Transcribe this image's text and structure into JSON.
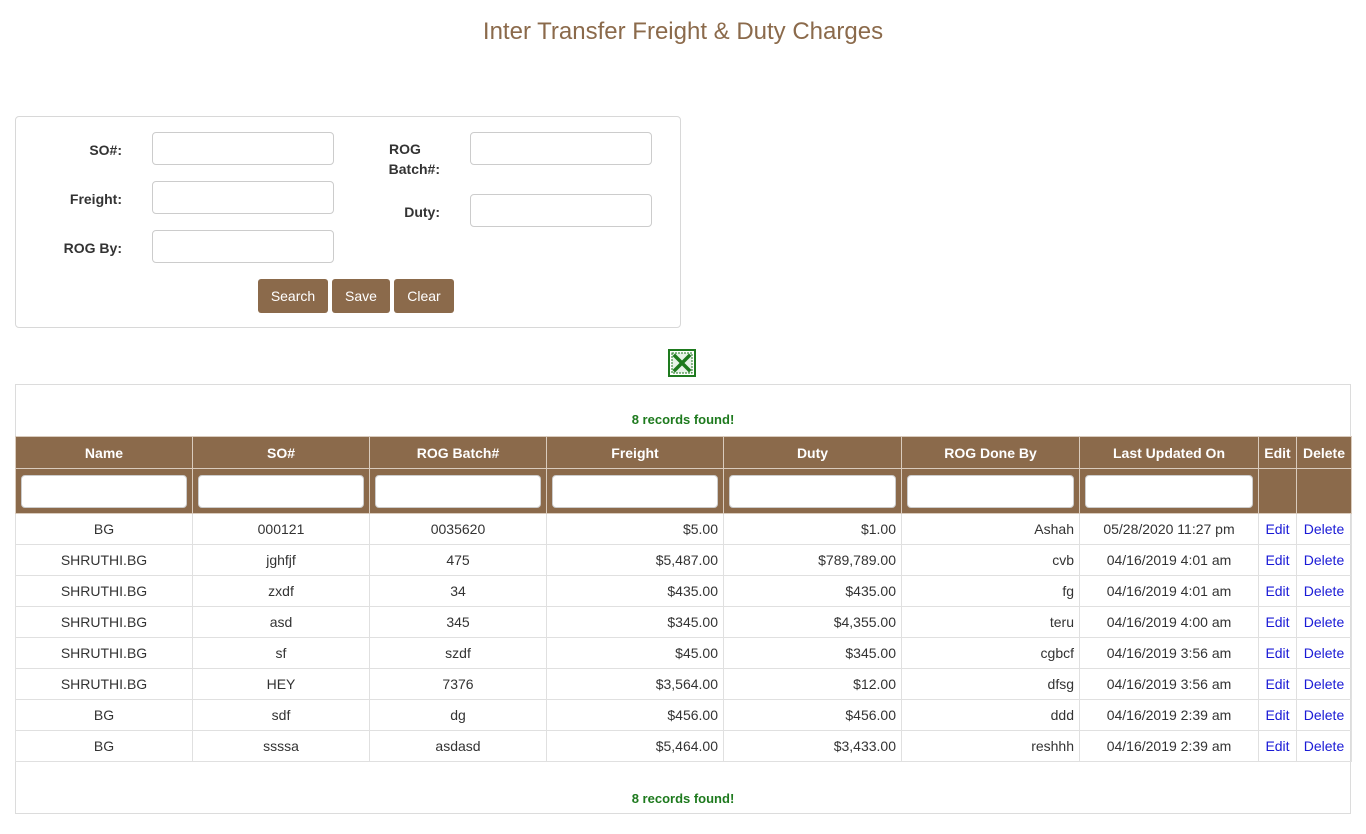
{
  "page": {
    "title": "Inter Transfer Freight & Duty Charges"
  },
  "form": {
    "so_label": "SO#:",
    "rog_batch_label_line1": "ROG",
    "rog_batch_label_line2": "Batch#:",
    "freight_label": "Freight:",
    "duty_label": "Duty:",
    "rog_by_label": "ROG By:",
    "so_value": "",
    "rog_batch_value": "",
    "freight_value": "",
    "duty_value": "",
    "rog_by_value": "",
    "search_label": "Search",
    "save_label": "Save",
    "clear_label": "Clear"
  },
  "export": {
    "icon": "excel-icon",
    "color": "#1e7a1e"
  },
  "grid": {
    "records_top": "8 records found!",
    "records_bottom": "8 records found!",
    "columns": [
      "Name",
      "SO#",
      "ROG Batch#",
      "Freight",
      "Duty",
      "ROG Done By",
      "Last Updated On",
      "Edit",
      "Delete"
    ],
    "rows": [
      {
        "name": "BG",
        "so": "000121",
        "batch": "0035620",
        "freight": "$5.00",
        "duty": "$1.00",
        "done_by": "Ashah",
        "updated": "05/28/2020 11:27 pm",
        "edit": "Edit",
        "delete": "Delete"
      },
      {
        "name": "SHRUTHI.BG",
        "so": "jghfjf",
        "batch": "475",
        "freight": "$5,487.00",
        "duty": "$789,789.00",
        "done_by": "cvb",
        "updated": "04/16/2019 4:01 am",
        "edit": "Edit",
        "delete": "Delete"
      },
      {
        "name": "SHRUTHI.BG",
        "so": "zxdf",
        "batch": "34",
        "freight": "$435.00",
        "duty": "$435.00",
        "done_by": "fg",
        "updated": "04/16/2019 4:01 am",
        "edit": "Edit",
        "delete": "Delete"
      },
      {
        "name": "SHRUTHI.BG",
        "so": "asd",
        "batch": "345",
        "freight": "$345.00",
        "duty": "$4,355.00",
        "done_by": "teru",
        "updated": "04/16/2019 4:00 am",
        "edit": "Edit",
        "delete": "Delete"
      },
      {
        "name": "SHRUTHI.BG",
        "so": "sf",
        "batch": "szdf",
        "freight": "$45.00",
        "duty": "$345.00",
        "done_by": "cgbcf",
        "updated": "04/16/2019 3:56 am",
        "edit": "Edit",
        "delete": "Delete"
      },
      {
        "name": "SHRUTHI.BG",
        "so": "HEY",
        "batch": "7376",
        "freight": "$3,564.00",
        "duty": "$12.00",
        "done_by": "dfsg",
        "updated": "04/16/2019 3:56 am",
        "edit": "Edit",
        "delete": "Delete"
      },
      {
        "name": "BG",
        "so": "sdf",
        "batch": "dg",
        "freight": "$456.00",
        "duty": "$456.00",
        "done_by": "ddd",
        "updated": "04/16/2019 2:39 am",
        "edit": "Edit",
        "delete": "Delete"
      },
      {
        "name": "BG",
        "so": "ssssa",
        "batch": "asdasd",
        "freight": "$5,464.00",
        "duty": "$3,433.00",
        "done_by": "reshhh",
        "updated": "04/16/2019 2:39 am",
        "edit": "Edit",
        "delete": "Delete"
      }
    ]
  },
  "colors": {
    "accent": "#8b6a4b",
    "success": "#1e7a1e",
    "link": "#1a1ad6"
  }
}
